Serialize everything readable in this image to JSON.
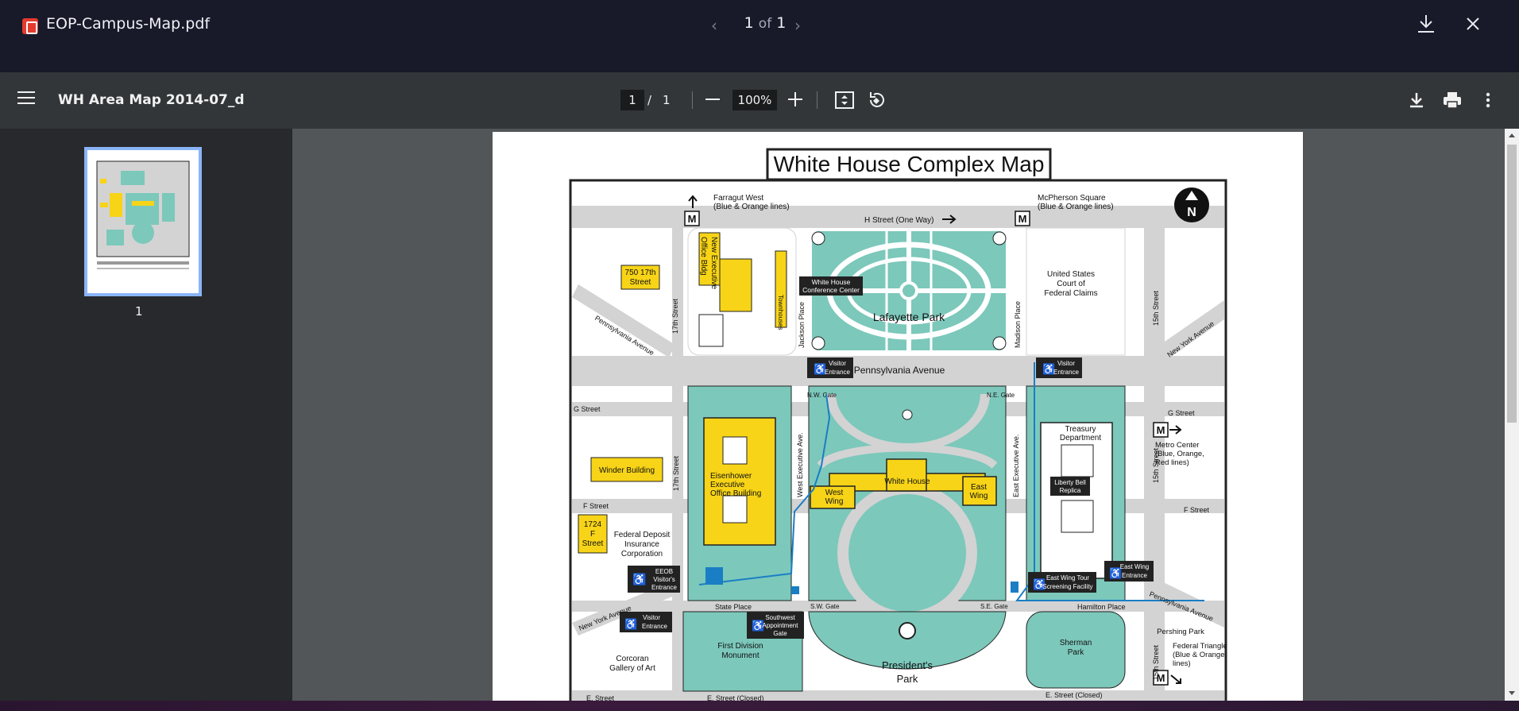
{
  "viewer": {
    "file_name": "EOP-Campus-Map.pdf",
    "page_current": "1",
    "page_of": "of",
    "page_total": "1"
  },
  "toolbar": {
    "doc_title": "WH Area Map 2014-07_d",
    "page_input": "1",
    "page_sep": "/",
    "page_total": "1",
    "zoom": "100%"
  },
  "sidebar": {
    "thumbnails": [
      {
        "label": "1"
      }
    ]
  },
  "map": {
    "title": "White House Complex Map",
    "labels": {
      "farragut": "Farragut West",
      "farragut_lines": "(Blue & Orange lines)",
      "mcpherson": "McPherson Square",
      "mcpherson_lines": "(Blue & Orange lines)",
      "h_street": "H  Street (One Way)",
      "north": "N",
      "metro_m": "M",
      "st_750_a": "750 17th",
      "st_750_b": "Street",
      "neob_a": "New Executive",
      "neob_b": "Office Bldg",
      "townhouses": "Townhouses",
      "whcc_a": "White House",
      "whcc_b": "Conference Center",
      "lafayette": "Lafayette Park",
      "jackson": "Jackson Place",
      "madison": "Madison  Place",
      "court_a": "United States",
      "court_b": "Court of",
      "court_c": "Federal Claims",
      "fifteenth": "15th Street",
      "seventeenth": "17th Street",
      "penn_ave_left": "Pennsylvania Avenue",
      "penn_ave": "Pennsylvania Avenue",
      "penn_ave_right": "Pennsylvania Avenue",
      "ny_ave_right": "New York Avenue",
      "ny_ave_left": "New York Avenue",
      "visitor": "Visitor",
      "entrance": "Entrance",
      "nw_gate": "N.W. Gate",
      "ne_gate": "N.E. Gate",
      "g_street": "G Street",
      "treasury_a": "Treasury",
      "treasury_b": "Department",
      "metro_center_a": "Metro Center",
      "metro_center_b": "(Blue, Orange,",
      "metro_center_c": "Red lines)",
      "eeob_a": "Eisenhower",
      "eeob_b": "Executive",
      "eeob_c": "Office Building",
      "west_exec": "West  Executive  Ave.",
      "east_exec": "East  Executive  Ave.",
      "white_house": "White House",
      "west_wing_a": "West",
      "west_wing_b": "Wing",
      "east_wing_a": "East",
      "east_wing_b": "Wing",
      "liberty_a": "Liberty Bell",
      "liberty_b": "Replica",
      "winder": "Winder Building",
      "f_street": "F Street",
      "f1724_a": "1724",
      "f1724_b": "F",
      "f1724_c": "Street",
      "fdic_a": "Federal Deposit",
      "fdic_b": "Insurance",
      "fdic_c": "Corporation",
      "eeob_visitor_a": "EEOB",
      "eeob_visitor_b": "Visitor's",
      "eeob_visitor_c": "Entrance",
      "state_place": "State Place",
      "sw_appt_a": "Southwest",
      "sw_appt_b": "Appointment",
      "sw_appt_c": "Gate",
      "sw_gate": "S.W. Gate",
      "se_gate": "S.E. Gate",
      "ew_tour_a": "East Wing Tour",
      "ew_tour_b": "Screening Facility",
      "ew_entrance_a": "East Wing",
      "ew_entrance_b": "Entrance",
      "hamilton": "Hamilton Place",
      "first_div_a": "First Division",
      "first_div_b": "Monument",
      "presidents_a": "President's",
      "presidents_b": "Park",
      "sherman_a": "Sherman",
      "sherman_b": "Park",
      "pershing": "Pershing Park",
      "fed_tri_a": "Federal Triangle",
      "fed_tri_b": "(Blue & Orange",
      "fed_tri_c": "lines)",
      "corcoran_a": "Corcoran",
      "corcoran_b": "Gallery of Art",
      "e_street": "E. Street",
      "e_closed": "E. Street (Closed)"
    }
  },
  "colors": {
    "topbar": "#181a2a",
    "toolbar": "#323639",
    "sidebar": "#27292c",
    "viewer_bg": "#525659",
    "map_green": "#7cc8bb",
    "map_yellow": "#f7d417",
    "map_road": "#d3d3d3",
    "map_blue": "#1a7ec4"
  },
  "icons": [
    "pdf-icon",
    "chevron-left-icon",
    "chevron-right-icon",
    "download-icon",
    "close-icon",
    "menu-icon",
    "zoom-out-icon",
    "zoom-in-icon",
    "fit-page-icon",
    "rotate-icon",
    "download-icon",
    "print-icon",
    "more-vert-icon",
    "wheelchair-icon",
    "metro-icon",
    "north-arrow-icon"
  ]
}
